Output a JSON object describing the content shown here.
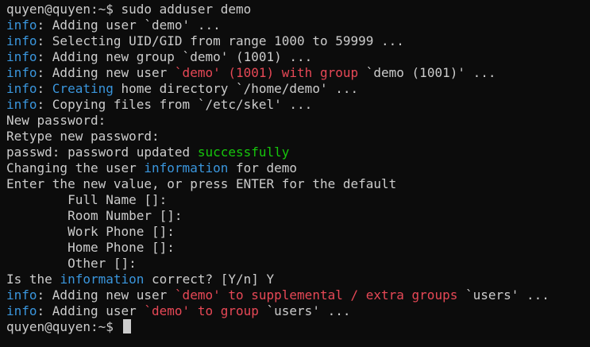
{
  "colors": {
    "background": "#0c0c0c",
    "default": "#cccccc",
    "info": "#3a96dd",
    "red": "#e74856",
    "green": "#16c60c"
  },
  "lines": [
    [
      {
        "t": "quyen@quyen:~$ sudo adduser demo",
        "c": "default"
      }
    ],
    [
      {
        "t": "info",
        "c": "info"
      },
      {
        "t": ": Adding user `demo' ...",
        "c": "default"
      }
    ],
    [
      {
        "t": "info",
        "c": "info"
      },
      {
        "t": ": Selecting UID/GID from range 1000 to 59999 ...",
        "c": "default"
      }
    ],
    [
      {
        "t": "info",
        "c": "info"
      },
      {
        "t": ": Adding new group `demo' (1001) ...",
        "c": "default"
      }
    ],
    [
      {
        "t": "info",
        "c": "info"
      },
      {
        "t": ": Adding new user ",
        "c": "default"
      },
      {
        "t": "`demo' (1001) with group ",
        "c": "red"
      },
      {
        "t": "`demo (1001)' ...",
        "c": "default"
      }
    ],
    [
      {
        "t": "info",
        "c": "info"
      },
      {
        "t": ": ",
        "c": "default"
      },
      {
        "t": "Creating",
        "c": "info"
      },
      {
        "t": " home directory `/home/demo' ...",
        "c": "default"
      }
    ],
    [
      {
        "t": "info",
        "c": "info"
      },
      {
        "t": ": Copying files from `/etc/skel' ...",
        "c": "default"
      }
    ],
    [
      {
        "t": "New password:",
        "c": "default"
      }
    ],
    [
      {
        "t": "Retype new password:",
        "c": "default"
      }
    ],
    [
      {
        "t": "passwd: password updated ",
        "c": "default"
      },
      {
        "t": "successfully",
        "c": "green"
      }
    ],
    [
      {
        "t": "Changing the user ",
        "c": "default"
      },
      {
        "t": "information",
        "c": "info"
      },
      {
        "t": " for demo",
        "c": "default"
      }
    ],
    [
      {
        "t": "Enter the new value, or press ENTER for the default",
        "c": "default"
      }
    ],
    [
      {
        "t": "        Full Name []:",
        "c": "default"
      }
    ],
    [
      {
        "t": "        Room Number []:",
        "c": "default"
      }
    ],
    [
      {
        "t": "        Work Phone []:",
        "c": "default"
      }
    ],
    [
      {
        "t": "        Home Phone []:",
        "c": "default"
      }
    ],
    [
      {
        "t": "        Other []:",
        "c": "default"
      }
    ],
    [
      {
        "t": "Is the ",
        "c": "default"
      },
      {
        "t": "information",
        "c": "info"
      },
      {
        "t": " correct? [Y/n] Y",
        "c": "default"
      }
    ],
    [
      {
        "t": "info",
        "c": "info"
      },
      {
        "t": ": Adding new user ",
        "c": "default"
      },
      {
        "t": "`demo' to supplemental / extra groups ",
        "c": "red"
      },
      {
        "t": "`users' ...",
        "c": "default"
      }
    ],
    [
      {
        "t": "info",
        "c": "info"
      },
      {
        "t": ": Adding user ",
        "c": "default"
      },
      {
        "t": "`demo' to group ",
        "c": "red"
      },
      {
        "t": "`users' ...",
        "c": "default"
      }
    ],
    [
      {
        "t": "quyen@quyen:~$ ",
        "c": "default"
      }
    ]
  ]
}
